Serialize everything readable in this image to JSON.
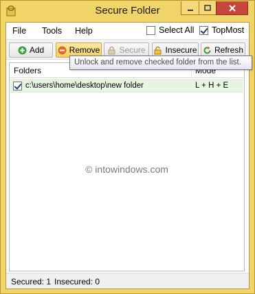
{
  "window": {
    "title": "Secure Folder",
    "accent_color": "#f0d468",
    "close_color": "#c7463a"
  },
  "menu": {
    "items": [
      "File",
      "Tools",
      "Help"
    ],
    "select_all": {
      "label": "Select All",
      "checked": false
    },
    "topmost": {
      "label": "TopMost",
      "checked": true
    }
  },
  "toolbar": {
    "buttons": [
      {
        "label": "Add",
        "icon": "add-icon",
        "enabled": true
      },
      {
        "label": "Remove",
        "icon": "remove-icon",
        "enabled": true
      },
      {
        "label": "Secure",
        "icon": "lock-icon",
        "enabled": false
      },
      {
        "label": "Insecure",
        "icon": "unlock-icon",
        "enabled": true
      },
      {
        "label": "Refresh",
        "icon": "refresh-icon",
        "enabled": true
      }
    ]
  },
  "tooltip": "Unlock and remove checked folder from the list.",
  "list": {
    "columns": [
      "Folders",
      "Mode"
    ],
    "rows": [
      {
        "path": "c:\\users\\home\\desktop\\new folder",
        "mode": "L + H + E",
        "checked": true
      }
    ]
  },
  "watermark": "© intowindows.com",
  "status": {
    "secured": "Secured: 1",
    "insecured": "Insecured: 0"
  }
}
